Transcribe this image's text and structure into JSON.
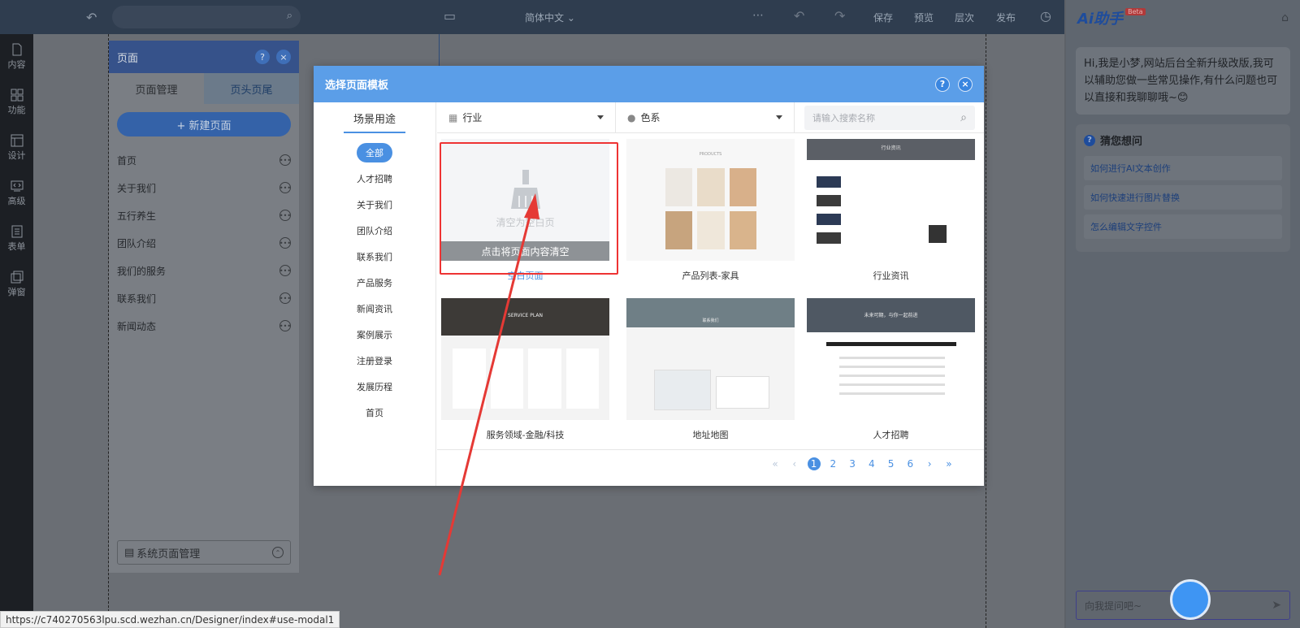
{
  "topbar": {
    "language": "简体中文",
    "save_label": "保存",
    "preview_label": "预览",
    "layers_label": "层次",
    "publish_label": "发布"
  },
  "leftrail": {
    "items": [
      {
        "label": "内容",
        "icon": "document-icon"
      },
      {
        "label": "功能",
        "icon": "grid-icon"
      },
      {
        "label": "设计",
        "icon": "layout-icon"
      },
      {
        "label": "高级",
        "icon": "code-icon"
      },
      {
        "label": "表单",
        "icon": "list-icon"
      },
      {
        "label": "弹窗",
        "icon": "popup-icon"
      }
    ]
  },
  "page_panel": {
    "title": "页面",
    "help": "?",
    "close": "×",
    "tabs": [
      "页面管理",
      "页头页尾"
    ],
    "new_page_label": "+ 新建页面",
    "pages": [
      "首页",
      "关于我们",
      "五行养生",
      "团队介绍",
      "我们的服务",
      "联系我们",
      "新闻动态"
    ],
    "footer_label": "系统页面管理"
  },
  "modal": {
    "title": "选择页面模板",
    "help": "?",
    "close": "×",
    "sidebar_title": "场景用途",
    "categories": [
      "全部",
      "人才招聘",
      "关于我们",
      "团队介绍",
      "联系我们",
      "产品服务",
      "新闻资讯",
      "案例展示",
      "注册登录",
      "发展历程",
      "首页"
    ],
    "filter_industry": "行业",
    "filter_color": "色系",
    "search_placeholder": "请输入搜索名称",
    "templates": [
      {
        "name": "空白页面",
        "overlay_label": "清空为空白页",
        "bar_label": "点击将页面内容清空"
      },
      {
        "name": "产品列表-家具",
        "thumb_title": "PRODUCTS"
      },
      {
        "name": "行业资讯",
        "thumb_title": "行业资讯"
      },
      {
        "name": "服务领域-金融/科技",
        "thumb_title": "SERVICE PLAN"
      },
      {
        "name": "地址地图",
        "thumb_title": "联系我们"
      },
      {
        "name": "人才招聘",
        "thumb_title": "未来可期，与你一起前进"
      }
    ],
    "pagination": {
      "pages": [
        "1",
        "2",
        "3",
        "4",
        "5",
        "6"
      ],
      "current": "1"
    }
  },
  "ai": {
    "title": "Ai助手",
    "badge": "Beta",
    "greeting": "Hi,我是小梦,网站后台全新升级改版,我可以辅助您做一些常见操作,有什么问题也可以直接和我聊聊哦~😊",
    "guess_title": "猜您想问",
    "questions": [
      "如何进行AI文本创作",
      "如何快速进行图片替换",
      "怎么编辑文字控件"
    ],
    "input_placeholder": "向我提问吧~"
  },
  "status_url": "https://c740270563lpu.scd.wezhan.cn/Designer/index#use-modal1"
}
